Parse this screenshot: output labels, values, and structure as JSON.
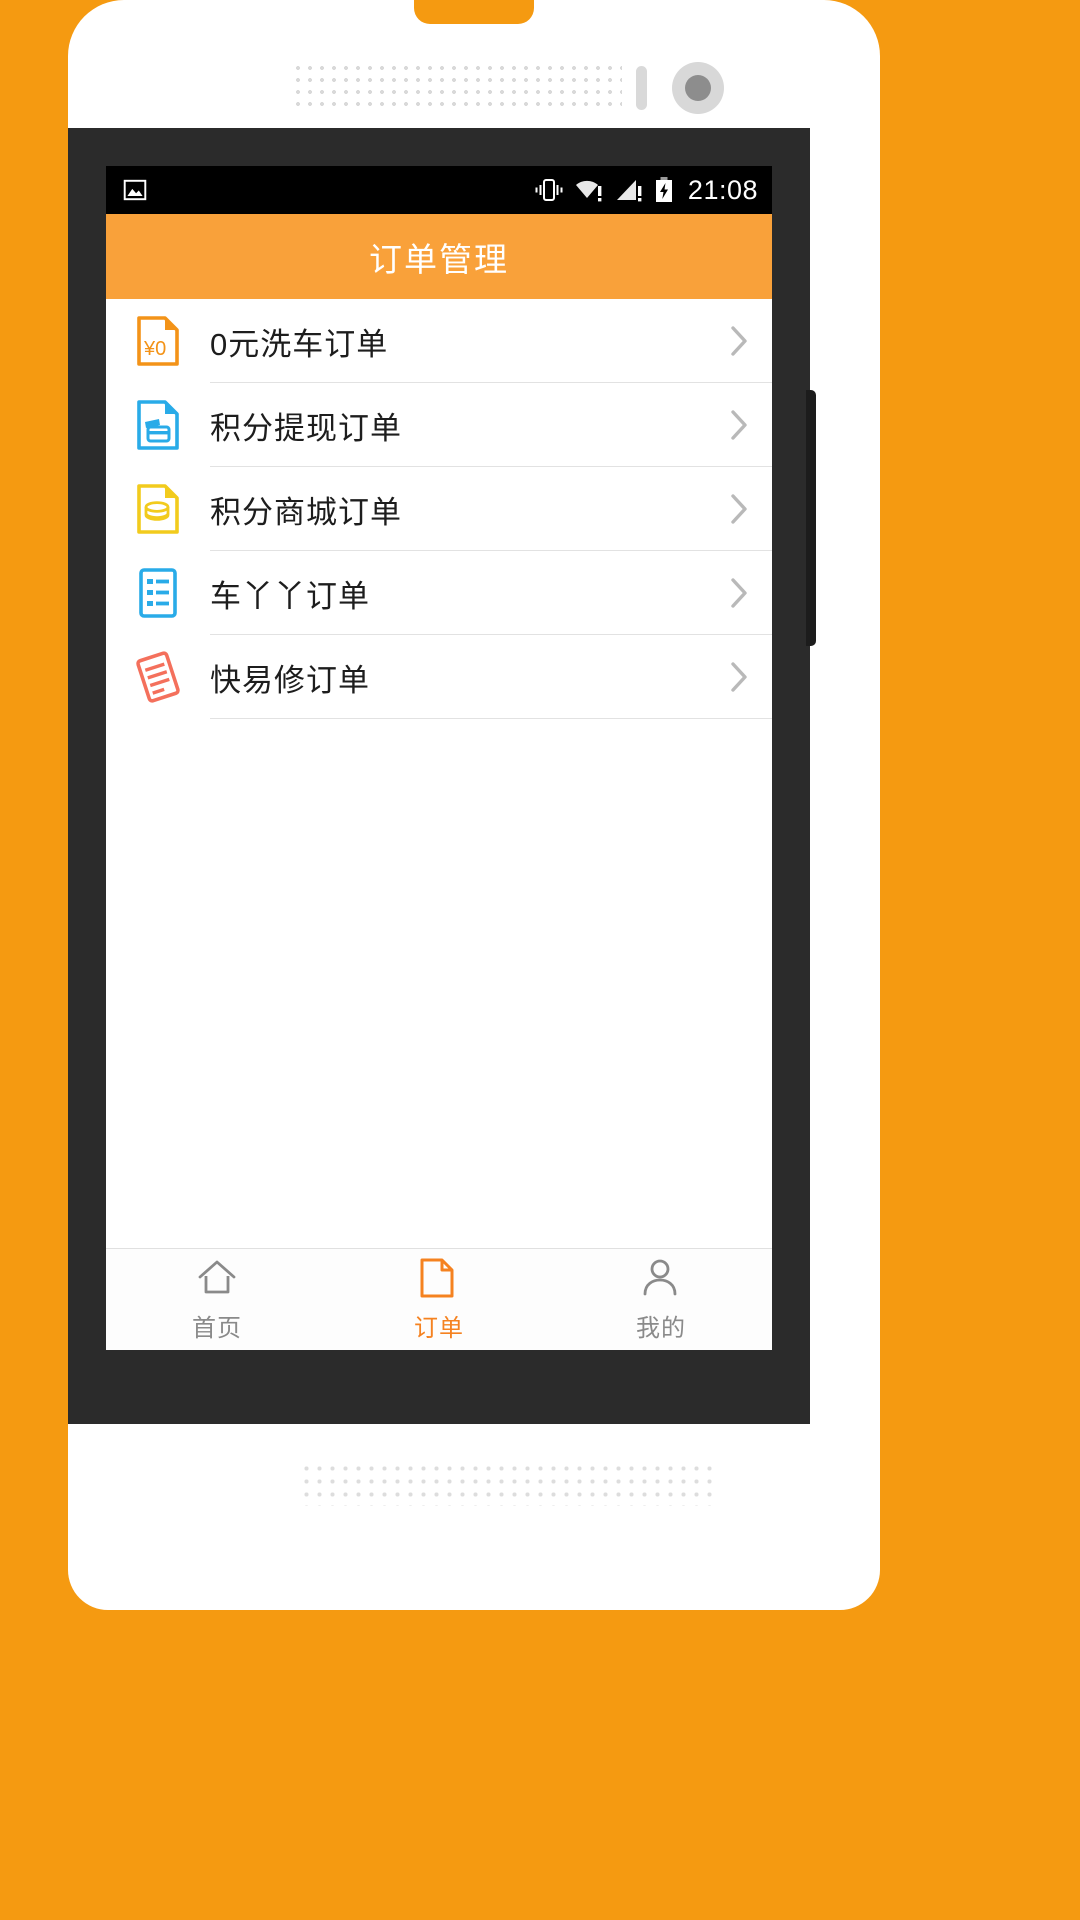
{
  "device": {
    "frame_color": "#FFFFFF",
    "bezel_color": "#2B2B2B",
    "background_color": "#F59A11"
  },
  "status_bar": {
    "time": "21:08",
    "background": "#000000",
    "icons_left": [
      "image-icon"
    ],
    "icons_right": [
      "vibrate-icon",
      "wifi-warning-icon",
      "signal-warning-icon",
      "battery-charging-icon"
    ]
  },
  "app_bar": {
    "title": "订单管理",
    "background": "#F9A13A",
    "text_color": "#FFFFFF"
  },
  "list": {
    "items": [
      {
        "label": "0元洗车订单",
        "icon": "yuan-zero-document-icon",
        "color": "#F39318",
        "badge": "¥0"
      },
      {
        "label": "积分提现订单",
        "icon": "card-withdraw-document-icon",
        "color": "#29ABE8"
      },
      {
        "label": "积分商城订单",
        "icon": "coins-document-icon",
        "color": "#F2CB1D"
      },
      {
        "label": "车丫丫订单",
        "icon": "list-document-icon",
        "color": "#29ABE8"
      },
      {
        "label": "快易修订单",
        "icon": "tilted-clipboard-icon",
        "color": "#F4705C"
      }
    ],
    "chevron": "chevron-right-icon",
    "divider_color": "#E2E2E2"
  },
  "tab_bar": {
    "active_color": "#F58220",
    "inactive_color": "#8A8A8A",
    "tabs": [
      {
        "label": "首页",
        "icon": "home-icon",
        "active": false
      },
      {
        "label": "订单",
        "icon": "document-icon",
        "active": true
      },
      {
        "label": "我的",
        "icon": "person-icon",
        "active": false
      }
    ]
  }
}
